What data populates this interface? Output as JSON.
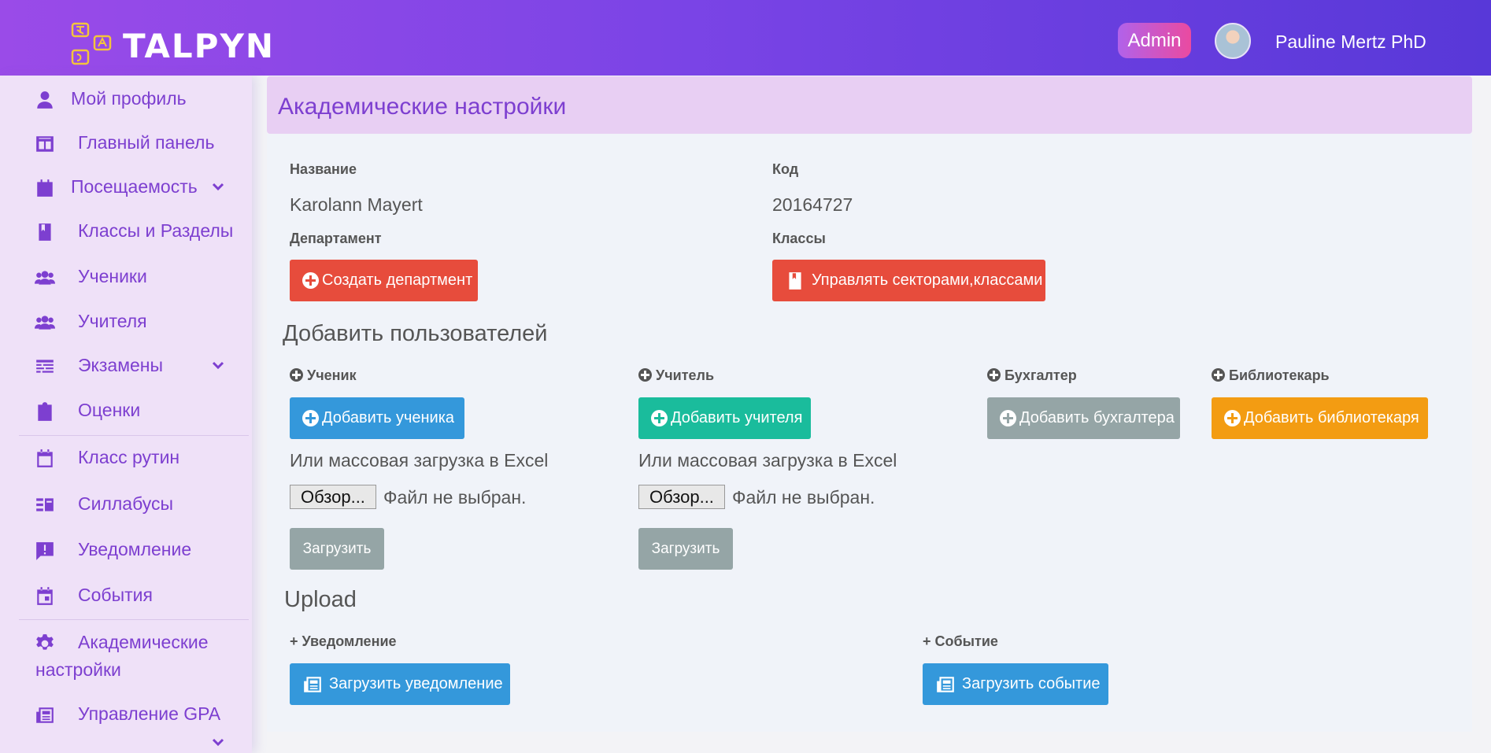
{
  "brand": {
    "name": "TALPYN"
  },
  "header": {
    "role": "Admin",
    "user_name": "Pauline Mertz PhD"
  },
  "sidebar": {
    "items": [
      {
        "label": "Мой профиль",
        "icon": "user-icon"
      },
      {
        "label": "Главный панель",
        "icon": "dashboard-icon"
      },
      {
        "label": "Посещаемость",
        "icon": "calendar-icon",
        "has_submenu": true
      },
      {
        "label": "Классы и Разделы",
        "icon": "book-icon"
      },
      {
        "label": "Ученики",
        "icon": "users-icon"
      },
      {
        "label": "Учителя",
        "icon": "users-icon"
      },
      {
        "label": "Экзамены",
        "icon": "table-icon",
        "has_submenu": true
      },
      {
        "label": "Оценки",
        "icon": "clipboard-icon"
      },
      {
        "label": "Класс рутин",
        "icon": "calendar-blank-icon"
      },
      {
        "label": "Силлабусы",
        "icon": "list-icon"
      },
      {
        "label": "Уведомление",
        "icon": "message-alert-icon"
      },
      {
        "label": "События",
        "icon": "calendar-event-icon"
      },
      {
        "label_line1": "Академические",
        "label_line2": "настройки",
        "icon": "gear-icon"
      },
      {
        "label": "Управление GPA",
        "icon": "newspaper-icon",
        "has_submenu": true
      }
    ]
  },
  "page": {
    "title": "Академические настройки"
  },
  "school": {
    "name_label": "Название",
    "name_value": "Karolann Mayert",
    "code_label": "Код",
    "code_value": "20164727",
    "department_label": "Департамент",
    "department_button": "Создать департмент",
    "classes_label": "Классы",
    "classes_button": "Управлять секторами,классами"
  },
  "add_users": {
    "title": "Добавить пользователей",
    "student": {
      "label": "Ученик",
      "button": "Добавить ученика"
    },
    "teacher": {
      "label": "Учитель",
      "button": "Добавить учителя"
    },
    "accountant": {
      "label": "Бухгалтер",
      "button": "Добавить бухгалтера"
    },
    "librarian": {
      "label": "Библиотекарь",
      "button": "Добавить библиотекаря"
    },
    "bulk_text": "Или массовая загрузка в Excel",
    "browse": "Обзор...",
    "no_file": "Файл не выбран.",
    "upload": "Загрузить"
  },
  "upload": {
    "title": "Upload",
    "notice": {
      "label": "+ Уведомление",
      "button": "Загрузить уведомление"
    },
    "event": {
      "label": "+ Событие",
      "button": "Загрузить событие"
    }
  },
  "colors": {
    "accent": "#7d3fd0",
    "red": "#e74c3c",
    "blue": "#3498db",
    "teal": "#1abc9c",
    "gray": "#95a5a6",
    "orange": "#f39c12"
  }
}
